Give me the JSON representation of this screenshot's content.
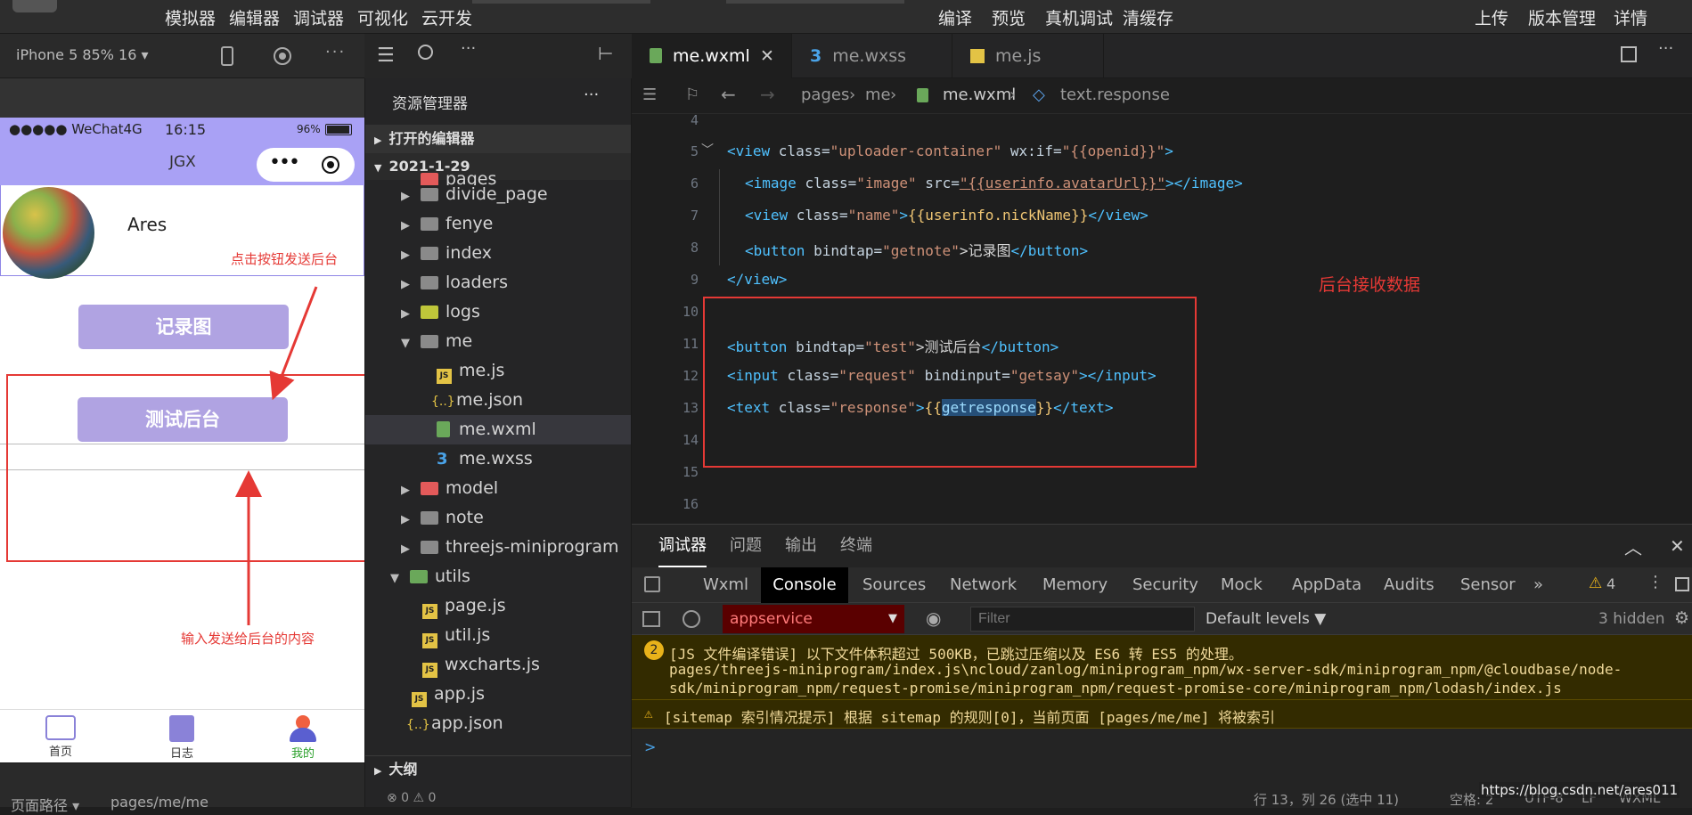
{
  "topbar": {
    "left": [
      "模拟器",
      "编辑器",
      "调试器",
      "可视化",
      "云开发"
    ],
    "center": [
      "编译",
      "预览",
      "真机调试",
      "清缓存"
    ],
    "right": [
      "上传",
      "版本管理",
      "详情"
    ]
  },
  "simulator": {
    "device": "iPhone 5 85% 16 ▾",
    "status_carrier": "●●●●● WeChat4G",
    "status_time": "16:15",
    "status_battery": "96%",
    "nav_title": "JGX",
    "profile_name": "Ares",
    "button_record": "记录图",
    "button_test": "测试后台",
    "tabs": [
      "首页",
      "日志",
      "我的"
    ],
    "footer_path_label": "页面路径 ▾",
    "footer_path": "pages/me/me"
  },
  "annotations": {
    "click_button": "点击按钮发送后台",
    "input_content": "输入发送给后台的内容",
    "backend_receive": "后台接收数据"
  },
  "explorer": {
    "title": "资源管理器",
    "open_editors": "打开的编辑器",
    "project": "2021-1-29",
    "pages_partial": "pages",
    "items": [
      {
        "name": "divide_page",
        "type": "folder",
        "level": 1
      },
      {
        "name": "fenye",
        "type": "folder",
        "level": 1
      },
      {
        "name": "index",
        "type": "folder",
        "level": 1
      },
      {
        "name": "loaders",
        "type": "folder",
        "level": 1
      },
      {
        "name": "logs",
        "type": "folder",
        "level": 1
      },
      {
        "name": "me",
        "type": "folder-open",
        "level": 1
      },
      {
        "name": "me.js",
        "type": "js",
        "level": 2
      },
      {
        "name": "me.json",
        "type": "json",
        "level": 2
      },
      {
        "name": "me.wxml",
        "type": "wxml",
        "level": 2
      },
      {
        "name": "me.wxss",
        "type": "wxss",
        "level": 2
      },
      {
        "name": "model",
        "type": "folder",
        "level": 1
      },
      {
        "name": "note",
        "type": "folder",
        "level": 1
      },
      {
        "name": "threejs-miniprogram",
        "type": "folder",
        "level": 1
      },
      {
        "name": "utils",
        "type": "folder-open",
        "level": 0
      },
      {
        "name": "page.js",
        "type": "js",
        "level": 1
      },
      {
        "name": "util.js",
        "type": "js",
        "level": 1
      },
      {
        "name": "wxcharts.js",
        "type": "js",
        "level": 1
      },
      {
        "name": "app.js",
        "type": "js",
        "level": 0
      },
      {
        "name": "app.json",
        "type": "json",
        "level": 0
      }
    ],
    "outline": "大纲",
    "problems": "⊗ 0 ⚠ 0"
  },
  "editor": {
    "tabs": [
      "me.wxml",
      "me.wxss",
      "me.js"
    ],
    "breadcrumbs": [
      "pages",
      "me",
      "me.wxml",
      "text.response"
    ],
    "lines": [
      "4",
      "5",
      "6",
      "7",
      "8",
      "9",
      "10",
      "11",
      "12",
      "13",
      "14",
      "15",
      "16"
    ],
    "code": {
      "l5_a": "<view ",
      "l5_b": "class=",
      "l5_c": "\"uploader-container\"",
      "l5_d": " wx:if=",
      "l5_e": "\"{{openid}}\"",
      "l5_f": ">",
      "l6_a": "<image ",
      "l6_b": "class=",
      "l6_c": "\"image\"",
      "l6_d": " src=",
      "l6_e": "\"{{userinfo.avatarUrl}}\"",
      "l6_f": "></image>",
      "l7_a": "<view ",
      "l7_b": "class=",
      "l7_c": "\"name\"",
      "l7_d": ">",
      "l7_e": "{{userinfo.nickName}}",
      "l7_f": "</view>",
      "l8_a": "<button ",
      "l8_b": "bindtap=",
      "l8_c": "\"getnote\"",
      "l8_d": ">记录图",
      "l8_e": "</button>",
      "l9": "</view>",
      "l11_a": "<button ",
      "l11_b": "bindtap=",
      "l11_c": "\"test\"",
      "l11_d": ">测试后台",
      "l11_e": "</button>",
      "l12_a": "<input ",
      "l12_b": "class=",
      "l12_c": "\"request\"",
      "l12_d": " bindinput=",
      "l12_e": "\"getsay\"",
      "l12_f": "></input>",
      "l13_a": "<text ",
      "l13_b": "class=",
      "l13_c": "\"response\"",
      "l13_d": ">",
      "l13_e": "{{",
      "l13_f": "getresponse",
      "l13_g": "}}",
      "l13_h": "</text>"
    }
  },
  "devtools": {
    "tabs": [
      "调试器",
      "问题",
      "输出",
      "终端"
    ],
    "console_tabs": [
      "Wxml",
      "Console",
      "Sources",
      "Network",
      "Memory",
      "Security",
      "Mock",
      "AppData",
      "Audits",
      "Sensor",
      "»"
    ],
    "warn_count": "4",
    "context": "appservice",
    "filter_placeholder": "Filter",
    "levels": "Default levels ▼",
    "hidden": "3 hidden",
    "msg1_badge": "2",
    "msg1_line1": "[JS 文件编译错误] 以下文件体积超过 500KB，已跳过压缩以及 ES6 转 ES5 的处理。",
    "msg1_line2": "pages/threejs-miniprogram/index.js\\ncloud/zanlog/miniprogram_npm/wx-server-sdk/miniprogram_npm/@cloudbase/node-",
    "msg1_line3": "sdk/miniprogram_npm/request-promise/miniprogram_npm/request-promise-core/miniprogram_npm/lodash/index.js",
    "msg2": "[sitemap 索引情况提示] 根据 sitemap 的规则[0]，当前页面 [pages/me/me] 将被索引",
    "prompt": ">",
    "status_pos": "行 13，列 26 (选中 11)",
    "status_space": "空格: 2",
    "status_enc": "UTF-8",
    "status_eol": "LF",
    "status_lang": "WXML",
    "watermark": "https://blog.csdn.net/ares011"
  },
  "colors": {
    "accent_purple": "#a9a1f5",
    "annotation_red": "#e53935",
    "warn_bg": "#332b00"
  }
}
